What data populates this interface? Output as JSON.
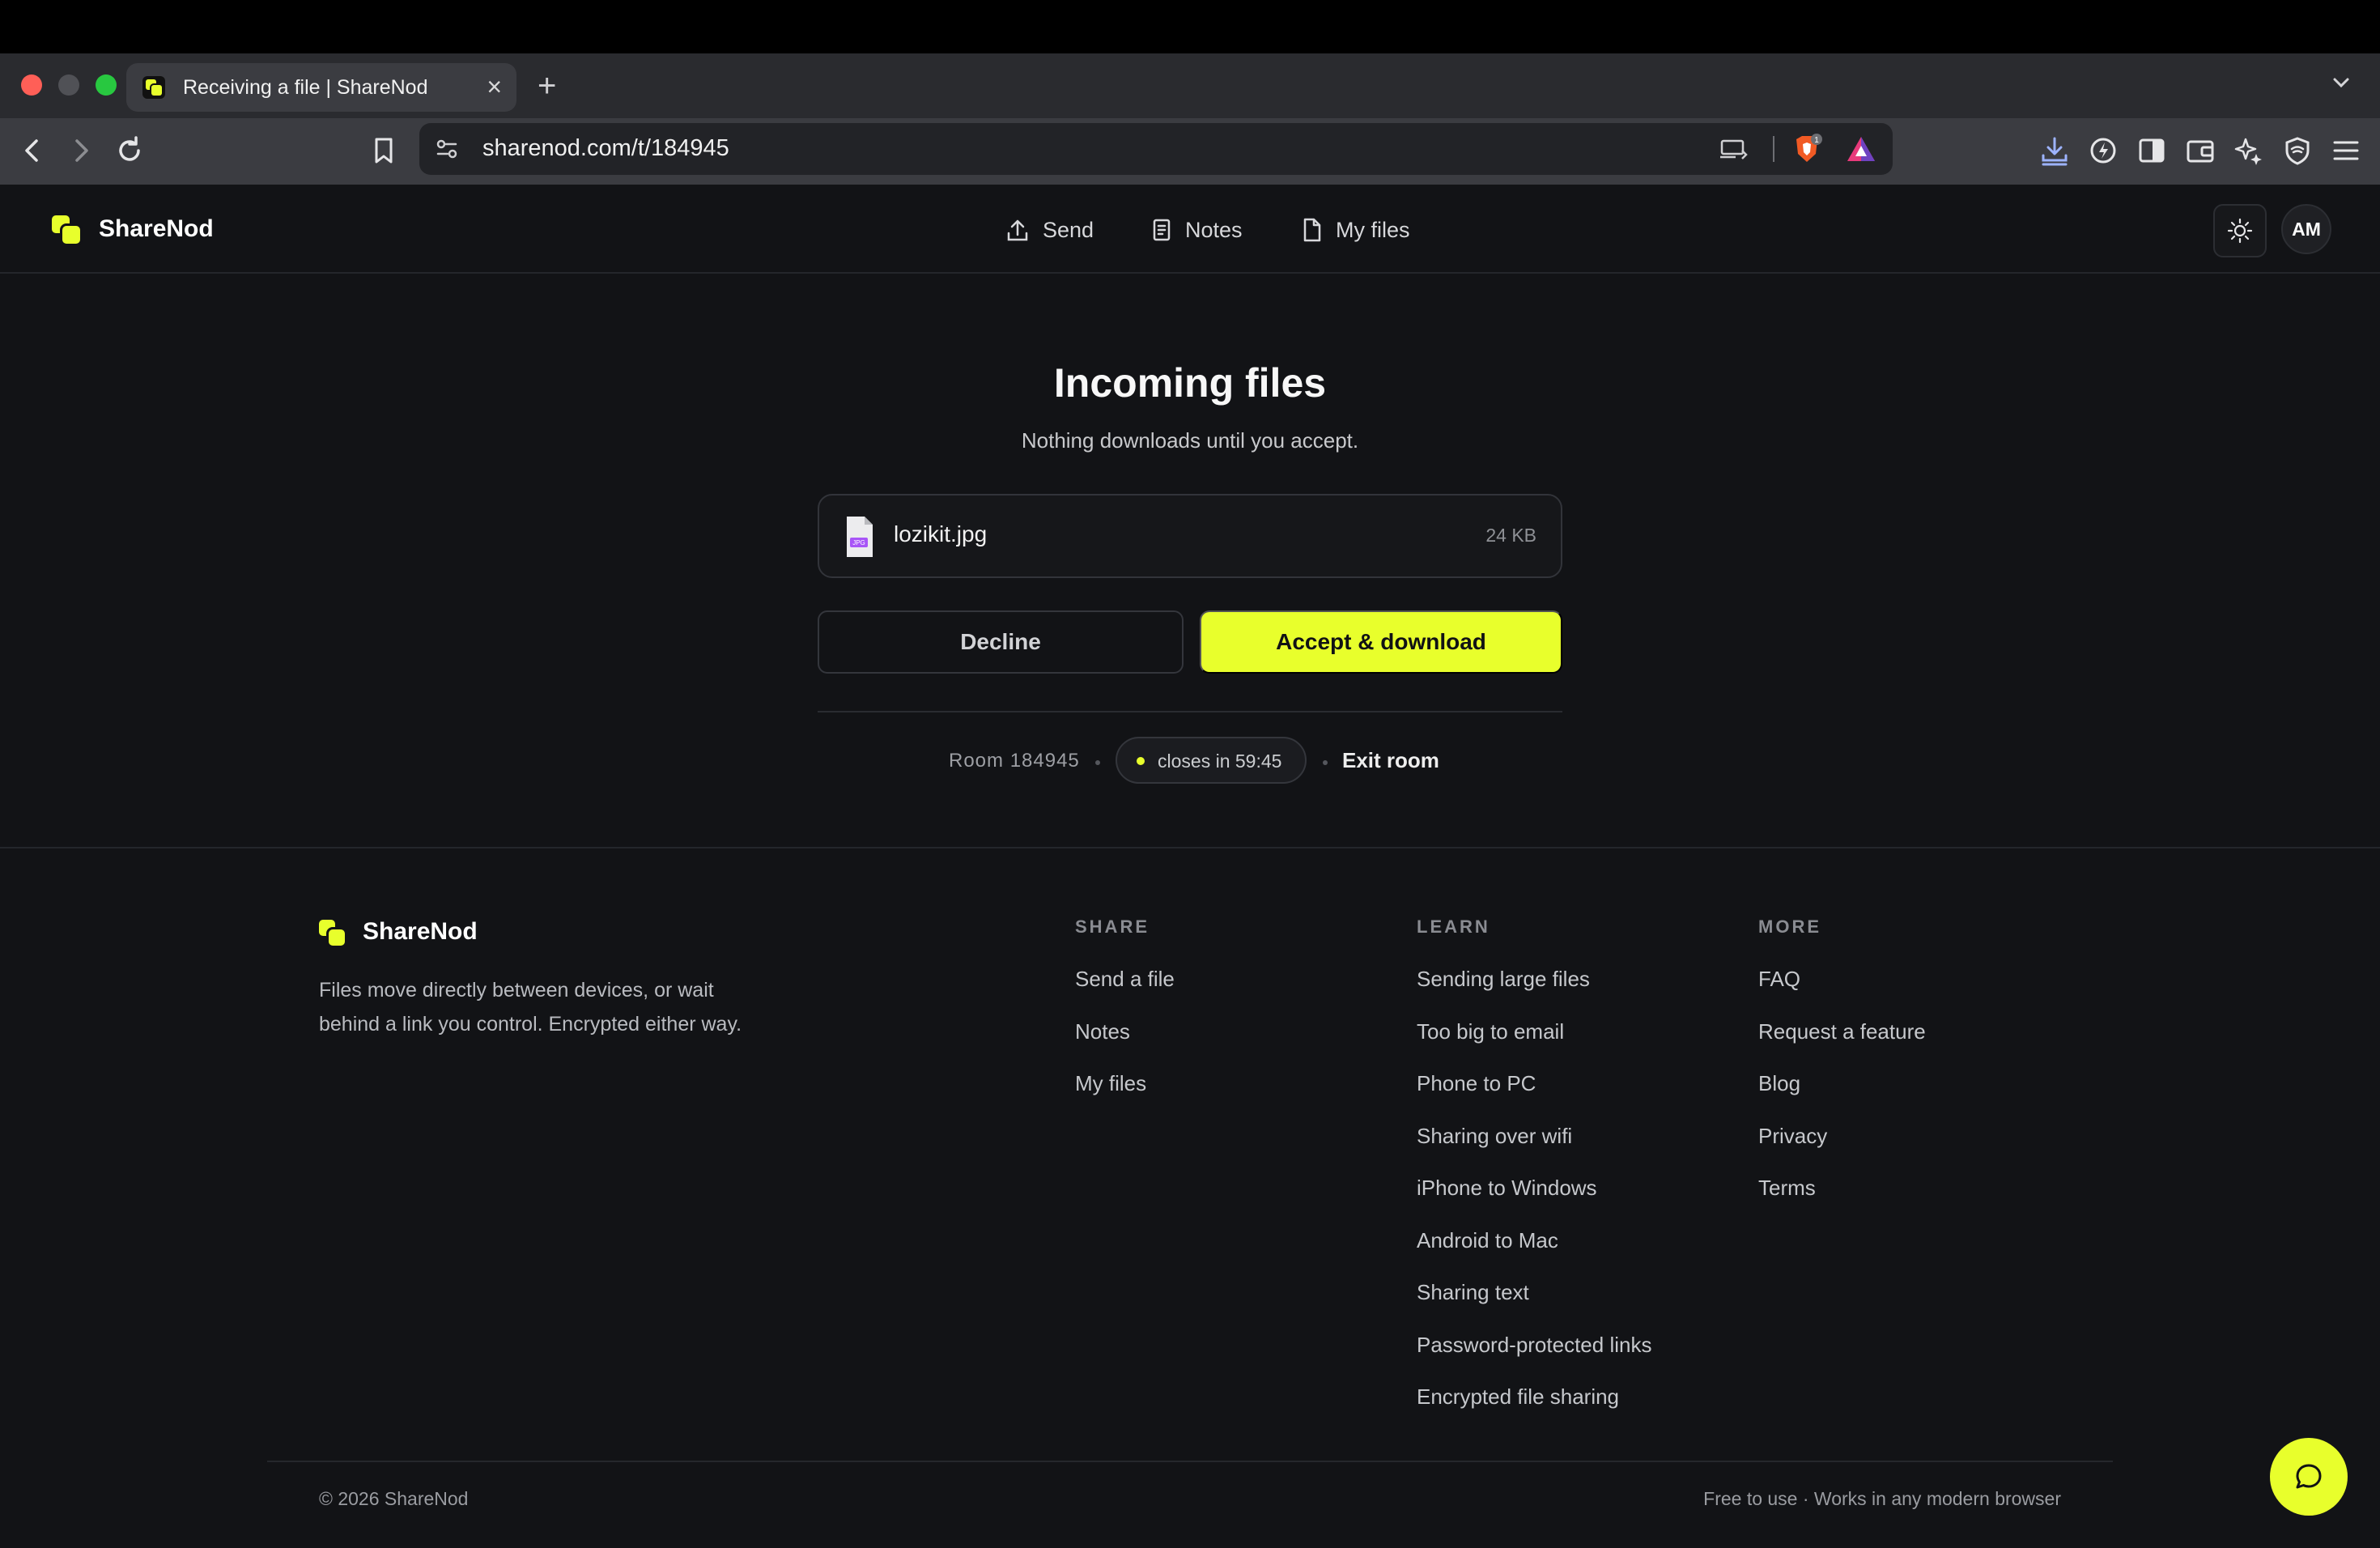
{
  "browser": {
    "tab_title": "Receiving a file | ShareNod",
    "tab_close": "×",
    "new_tab": "+",
    "url": "sharenod.com/t/184945",
    "brave_badge": "1"
  },
  "header": {
    "brand": "ShareNod",
    "nav": [
      {
        "label": "Send",
        "icon": "upload-icon"
      },
      {
        "label": "Notes",
        "icon": "notes-icon"
      },
      {
        "label": "My files",
        "icon": "file-icon"
      }
    ],
    "avatar_initials": "AM"
  },
  "main": {
    "title": "Incoming files",
    "subtitle": "Nothing downloads until you accept.",
    "file": {
      "name": "lozikit.jpg",
      "size": "24 KB",
      "type_badge": "JPG"
    },
    "decline_label": "Decline",
    "accept_label": "Accept & download",
    "room_label": "Room 184945",
    "timer_label": "closes in 59:45",
    "exit_label": "Exit room"
  },
  "footer": {
    "brand": "ShareNod",
    "description": "Files move directly between devices, or wait behind a link you control. Encrypted either way.",
    "columns": [
      {
        "heading": "SHARE",
        "links": [
          "Send a file",
          "Notes",
          "My files"
        ]
      },
      {
        "heading": "LEARN",
        "links": [
          "Sending large files",
          "Too big to email",
          "Phone to PC",
          "Sharing over wifi",
          "iPhone to Windows",
          "Android to Mac",
          "Sharing text",
          "Password-protected links",
          "Encrypted file sharing"
        ]
      },
      {
        "heading": "MORE",
        "links": [
          "FAQ",
          "Request a feature",
          "Blog",
          "Privacy",
          "Terms"
        ]
      }
    ],
    "copyright": "© 2026 ShareNod",
    "tagline": "Free to use · Works in any modern browser"
  },
  "colors": {
    "accent": "#e8ff2c",
    "background": "#121316",
    "chrome": "#3b3c41"
  }
}
